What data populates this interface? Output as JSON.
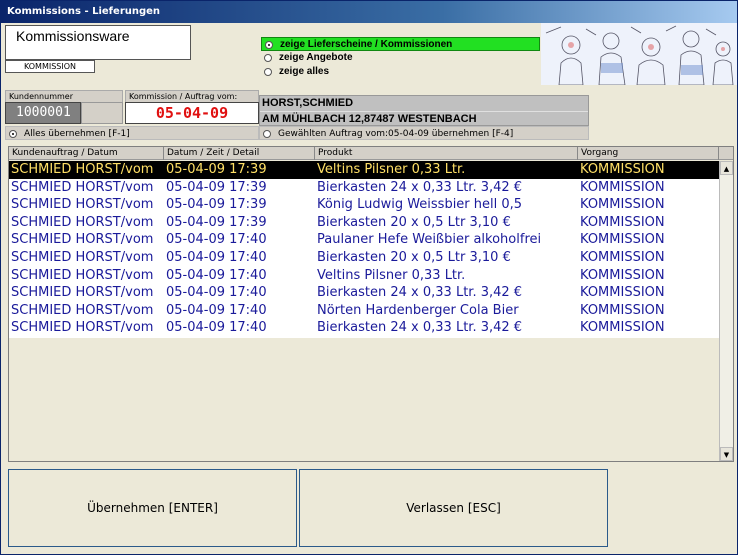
{
  "window": {
    "title": "Kommissions - Lieferungen"
  },
  "ware": {
    "title": "Kommissionsware",
    "badge": "KOMMISSION"
  },
  "filter": {
    "options": [
      {
        "label": "zeige Lieferscheine / Kommissionen",
        "selected": true
      },
      {
        "label": "zeige Angebote",
        "selected": false
      },
      {
        "label": "zeige alles",
        "selected": false
      }
    ]
  },
  "customer": {
    "number_label": "Kundennummer",
    "number": "1000001",
    "order_label": "Kommission / Auftrag vom:",
    "order_date": "05-04-09",
    "name": "HORST,SCHMIED",
    "address": "AM MÜHLBACH 12,87487  WESTENBACH"
  },
  "options": {
    "take_all": "Alles übernehmen [F-1]",
    "take_selected": "Gewählten Auftrag vom:05-04-09 übernehmen  [F-4]"
  },
  "table": {
    "headers": [
      "Kundenauftrag / Datum",
      "Datum / Zeit / Detail",
      "Produkt",
      "Vorgang"
    ],
    "rows": [
      [
        "SCHMIED HORST/vom",
        "05-04-09   17:39",
        "Veltins Pilsner 0,33 Ltr.",
        "KOMMISSION"
      ],
      [
        "SCHMIED HORST/vom",
        "05-04-09   17:39",
        "Bierkasten 24 x 0,33 Ltr.    3,42 €",
        "KOMMISSION"
      ],
      [
        "SCHMIED HORST/vom",
        "05-04-09   17:39",
        "König Ludwig Weissbier hell 0,5",
        "KOMMISSION"
      ],
      [
        "SCHMIED HORST/vom",
        "05-04-09   17:39",
        "Bierkasten 20 x 0,5 Ltr    3,10 €",
        "KOMMISSION"
      ],
      [
        "SCHMIED HORST/vom",
        "05-04-09   17:40",
        "Paulaner Hefe Weißbier alkoholfrei",
        "KOMMISSION"
      ],
      [
        "SCHMIED HORST/vom",
        "05-04-09   17:40",
        "Bierkasten 20 x 0,5 Ltr    3,10 €",
        "KOMMISSION"
      ],
      [
        "SCHMIED HORST/vom",
        "05-04-09   17:40",
        "Veltins Pilsner 0,33 Ltr.",
        "KOMMISSION"
      ],
      [
        "SCHMIED HORST/vom",
        "05-04-09   17:40",
        "Bierkasten 24 x 0,33 Ltr.    3,42 €",
        "KOMMISSION"
      ],
      [
        "SCHMIED HORST/vom",
        "05-04-09   17:40",
        "Nörten Hardenberger Cola Bier",
        "KOMMISSION"
      ],
      [
        "SCHMIED HORST/vom",
        "05-04-09   17:40",
        "Bierkasten 24 x 0,33 Ltr.    3,42 €",
        "KOMMISSION"
      ]
    ],
    "selected_row": 0
  },
  "buttons": {
    "accept": "Übernehmen [ENTER]",
    "leave": "Verlassen [ESC]"
  }
}
